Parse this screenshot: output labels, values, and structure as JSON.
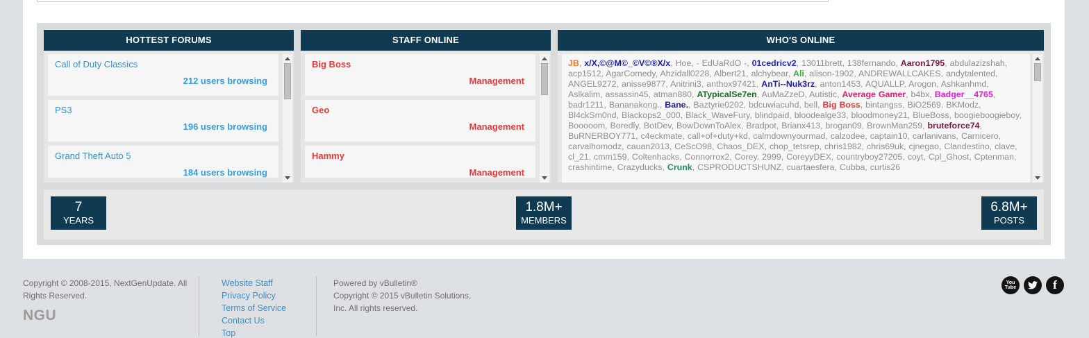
{
  "forums": {
    "title": "HOTTEST FORUMS",
    "items": [
      {
        "name": "Call of Duty Classics",
        "browsing": "212 users browsing"
      },
      {
        "name": "PS3",
        "browsing": "196 users browsing"
      },
      {
        "name": "Grand Theft Auto 5",
        "browsing": "184 users browsing"
      }
    ]
  },
  "staff": {
    "title": "STAFF ONLINE",
    "items": [
      {
        "name": "Big Boss",
        "role": "Management"
      },
      {
        "name": "Geo",
        "role": "Management"
      },
      {
        "name": "Hammy",
        "role": "Management"
      }
    ]
  },
  "online": {
    "title": "WHO'S ONLINE",
    "users": [
      {
        "n": "JB",
        "c": "#f07a2a",
        "b": true
      },
      {
        "n": "x/X,©@M©_©V©®X/x",
        "c": "#1c1ca8",
        "b": true
      },
      {
        "n": "Hoe"
      },
      {
        "n": "- EdUaRdO -"
      },
      {
        "n": "01cedricv2",
        "c": "#2323c8",
        "b": true
      },
      {
        "n": "13011brett"
      },
      {
        "n": "138fernando"
      },
      {
        "n": "Aaron1795",
        "c": "#7a1a44",
        "b": true
      },
      {
        "n": "abdulazizshah"
      },
      {
        "n": "acp1512"
      },
      {
        "n": "AgarComedy"
      },
      {
        "n": "Ahzidall0228"
      },
      {
        "n": "Albert21"
      },
      {
        "n": "alchybear"
      },
      {
        "n": "Ali",
        "c": "#3ab53a",
        "b": true
      },
      {
        "n": "alison-1902"
      },
      {
        "n": "ANDREWALLCAKES"
      },
      {
        "n": "andytalented"
      },
      {
        "n": "ANGEL9272"
      },
      {
        "n": "anisse9877"
      },
      {
        "n": "Anitrini3"
      },
      {
        "n": "anthox97421"
      },
      {
        "n": "AnTi--Nuk3rz",
        "c": "#1c1ca8",
        "b": true
      },
      {
        "n": "anton1453"
      },
      {
        "n": "AQUALLP"
      },
      {
        "n": "Arogon"
      },
      {
        "n": "Ashkanhmd"
      },
      {
        "n": "Aslkalim"
      },
      {
        "n": "assassin45"
      },
      {
        "n": "atman880"
      },
      {
        "n": "ATypicalSe7en",
        "c": "#1e6b1e",
        "b": true
      },
      {
        "n": "AuMaZzeD"
      },
      {
        "n": "Autistic"
      },
      {
        "n": "Average Gamer",
        "c": "#d6236a",
        "b": true
      },
      {
        "n": "b4bx"
      },
      {
        "n": "Badger__4765",
        "c": "#e01ce0",
        "b": true
      },
      {
        "n": "badr1211"
      },
      {
        "n": "Bananakong."
      },
      {
        "n": "Bane.",
        "c": "#1c1ca8",
        "b": true
      },
      {
        "n": "Baztyrie0202"
      },
      {
        "n": "bdcuwiacuhd"
      },
      {
        "n": "bell"
      },
      {
        "n": "Big Boss",
        "c": "#e03b3b",
        "b": true
      },
      {
        "n": "bintangss"
      },
      {
        "n": "BiO2569"
      },
      {
        "n": "BKModz"
      },
      {
        "n": "Bl4ckSm0nd"
      },
      {
        "n": "Blackops2_000"
      },
      {
        "n": "Black_WaveFury"
      },
      {
        "n": "blindpaid"
      },
      {
        "n": "bloodealge33"
      },
      {
        "n": "bloodmoney21"
      },
      {
        "n": "BlueBoss"
      },
      {
        "n": "boogieboogieboy"
      },
      {
        "n": "Booooom"
      },
      {
        "n": "Boredly"
      },
      {
        "n": "BotDev"
      },
      {
        "n": "BowDownToAlex"
      },
      {
        "n": "Bradpot"
      },
      {
        "n": "Brianx413"
      },
      {
        "n": "brogan09"
      },
      {
        "n": "BrownMan259"
      },
      {
        "n": "bruteforce74",
        "c": "#7a1a44",
        "b": true
      },
      {
        "n": "BuRNERBOY771"
      },
      {
        "n": "c4eckmate"
      },
      {
        "n": "call+of+duty+kd"
      },
      {
        "n": "calmdownyourmad"
      },
      {
        "n": "calzodee"
      },
      {
        "n": "captain10"
      },
      {
        "n": "carlanivans"
      },
      {
        "n": "Carnicero"
      },
      {
        "n": "carvalhomodz"
      },
      {
        "n": "cauan2013"
      },
      {
        "n": "CeScO98"
      },
      {
        "n": "Chaos_DEX"
      },
      {
        "n": "chop_tetsrep"
      },
      {
        "n": "chris1982"
      },
      {
        "n": "chris69uk"
      },
      {
        "n": "cjnegao"
      },
      {
        "n": "Clandestino"
      },
      {
        "n": "clave"
      },
      {
        "n": "cl_21"
      },
      {
        "n": "cmm159"
      },
      {
        "n": "Coltenhacks"
      },
      {
        "n": "Connorrox2"
      },
      {
        "n": "Corey. 2999"
      },
      {
        "n": "CoreyyDEX"
      },
      {
        "n": "countryboy27205"
      },
      {
        "n": "coyt"
      },
      {
        "n": "Cpl_Ghost"
      },
      {
        "n": "Cptenman"
      },
      {
        "n": "crashintime"
      },
      {
        "n": "Crazyducks"
      },
      {
        "n": "Crunk",
        "c": "#1e8b5e",
        "b": true
      },
      {
        "n": "CSPRODUCTSHUNZ"
      },
      {
        "n": "cuartaesfera"
      },
      {
        "n": "Cubba"
      },
      {
        "n": "curtis26"
      }
    ]
  },
  "stats": [
    {
      "value": "7",
      "label": "YEARS"
    },
    {
      "value": "1.8M+",
      "label": "MEMBERS"
    },
    {
      "value": "6.8M+",
      "label": "POSTS"
    }
  ],
  "footer": {
    "copyright": "Copyright © 2008-2015, NextGenUpdate. All Rights Reserved.",
    "logo": "NGU",
    "links": [
      "Website Staff",
      "Privacy Policy",
      "Terms of Service",
      "Contact Us",
      "Top"
    ],
    "powered_by": "Powered by vBulletin®",
    "vb_copyright": "Copyright © 2015 vBulletin Solutions, Inc. All rights reserved."
  },
  "social": [
    {
      "icon": "youtube-icon",
      "glyph": "You Tube"
    },
    {
      "icon": "twitter-icon",
      "glyph": "🐦"
    },
    {
      "icon": "facebook-icon",
      "glyph": "f"
    }
  ]
}
